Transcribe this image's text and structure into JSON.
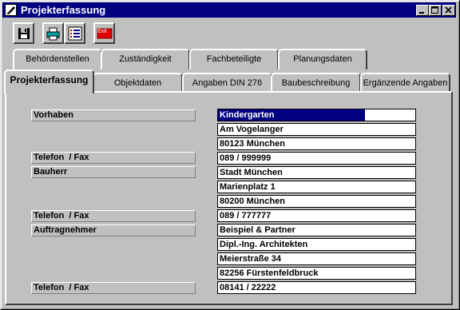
{
  "window": {
    "title": "Projekterfassung"
  },
  "toolbar": {
    "exit_label": "Exit"
  },
  "tabs_row1": [
    {
      "label": "Behördenstellen"
    },
    {
      "label": "Zuständigkeit"
    },
    {
      "label": "Fachbeteiligte"
    },
    {
      "label": "Planungsdaten"
    }
  ],
  "tabs_row2": [
    {
      "label": "Projekterfassung"
    },
    {
      "label": "Objektdaten"
    },
    {
      "label": "Angaben DIN 276"
    },
    {
      "label": "Baubeschreibung"
    },
    {
      "label": "Ergänzende Angaben"
    }
  ],
  "labels": {
    "vorhaben": "Vorhaben",
    "telefon1": "Telefon  / Fax",
    "bauherr": "Bauherr",
    "telefon2": "Telefon  / Fax",
    "auftragnehmer": "Auftragnehmer",
    "telefon3": "Telefon  / Fax"
  },
  "fields": [
    "Kindergarten",
    "Am Vogelanger",
    "80123  München",
    "089 / 999999",
    "Stadt München",
    "Marienplatz 1",
    "80200 München",
    "089 / 777777",
    "Beispiel & Partner",
    "Dipl.-Ing. Architekten",
    "Meierstraße 34",
    "82256 Fürstenfeldbruck",
    "08141 / 22222"
  ]
}
